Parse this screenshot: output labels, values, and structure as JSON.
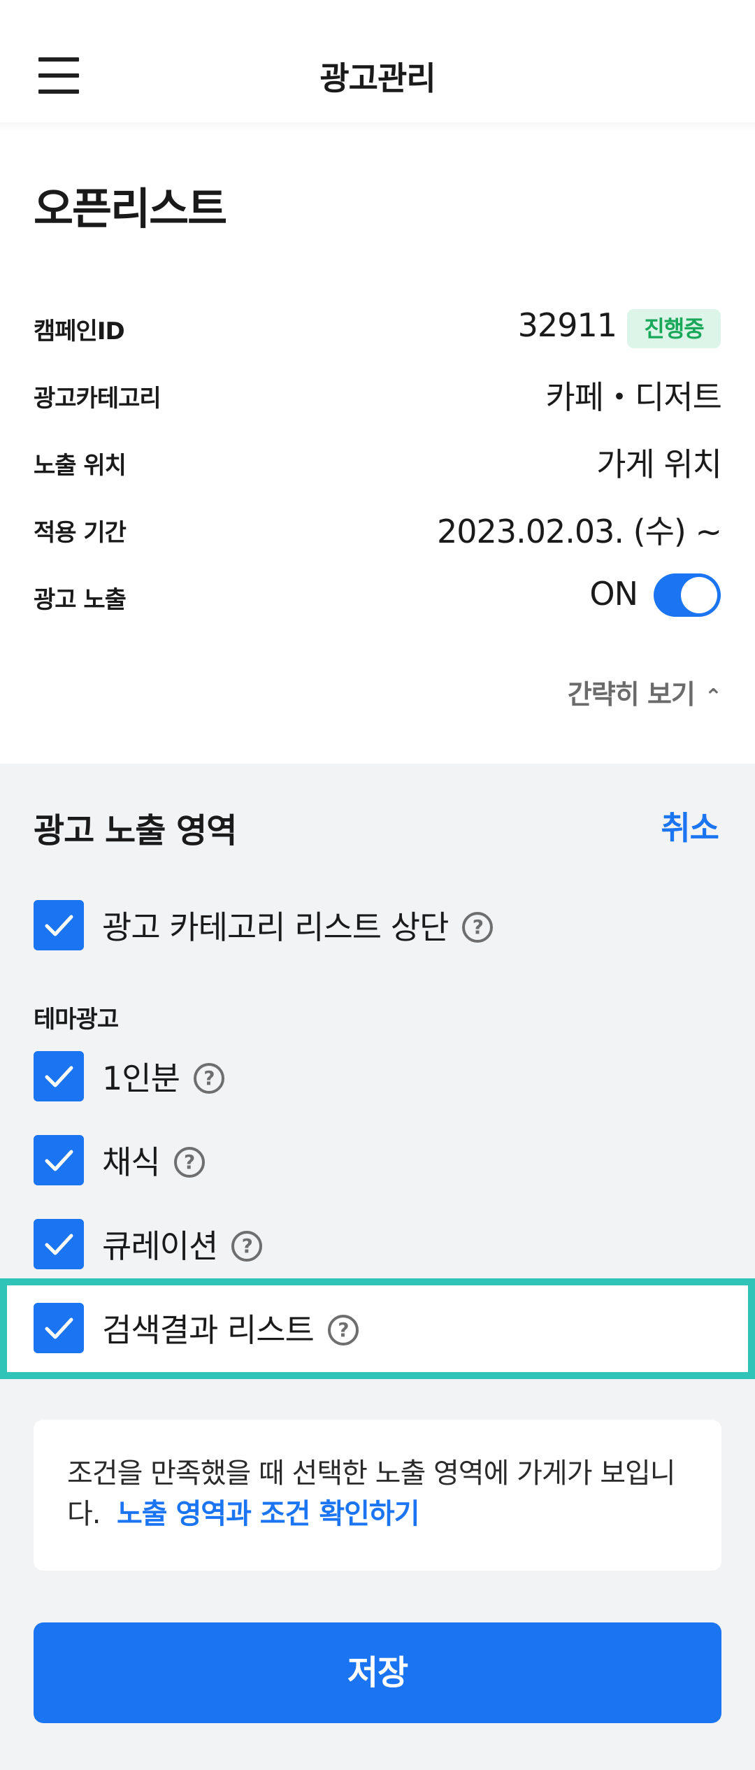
{
  "header": {
    "title": "광고관리"
  },
  "page_title": "오픈리스트",
  "details": {
    "campaign": {
      "label": "캠페인ID",
      "value": "32911",
      "status": "진행중"
    },
    "category": {
      "label": "광고카테고리",
      "value": "카페・디저트"
    },
    "location": {
      "label": "노출 위치",
      "value": "가게 위치"
    },
    "period": {
      "label": "적용 기간",
      "value": "2023.02.03. (수) ~"
    },
    "exposure": {
      "label": "광고 노출",
      "value": "ON",
      "toggle_on": true
    }
  },
  "collapse_label": "간략히 보기",
  "exposure_area": {
    "title": "광고 노출 영역",
    "cancel_label": "취소",
    "top_option": {
      "label": "광고 카테고리 리스트 상단",
      "checked": true
    },
    "theme_label": "테마광고",
    "theme_options": [
      {
        "label": "1인분",
        "checked": true
      },
      {
        "label": "채식",
        "checked": true
      },
      {
        "label": "큐레이션",
        "checked": true
      },
      {
        "label": "검색결과 리스트",
        "checked": true
      }
    ]
  },
  "info": {
    "text": "조건을 만족했을 때 선택한 노출 영역에 가게가 보입니다.",
    "link": "노출 영역과 조건 확인하기"
  },
  "save_label": "저장",
  "colors": {
    "accent": "#1b74f2",
    "highlight": "#2fc4b7",
    "status_bg": "#dcf5e8",
    "status_text": "#19a85a"
  }
}
